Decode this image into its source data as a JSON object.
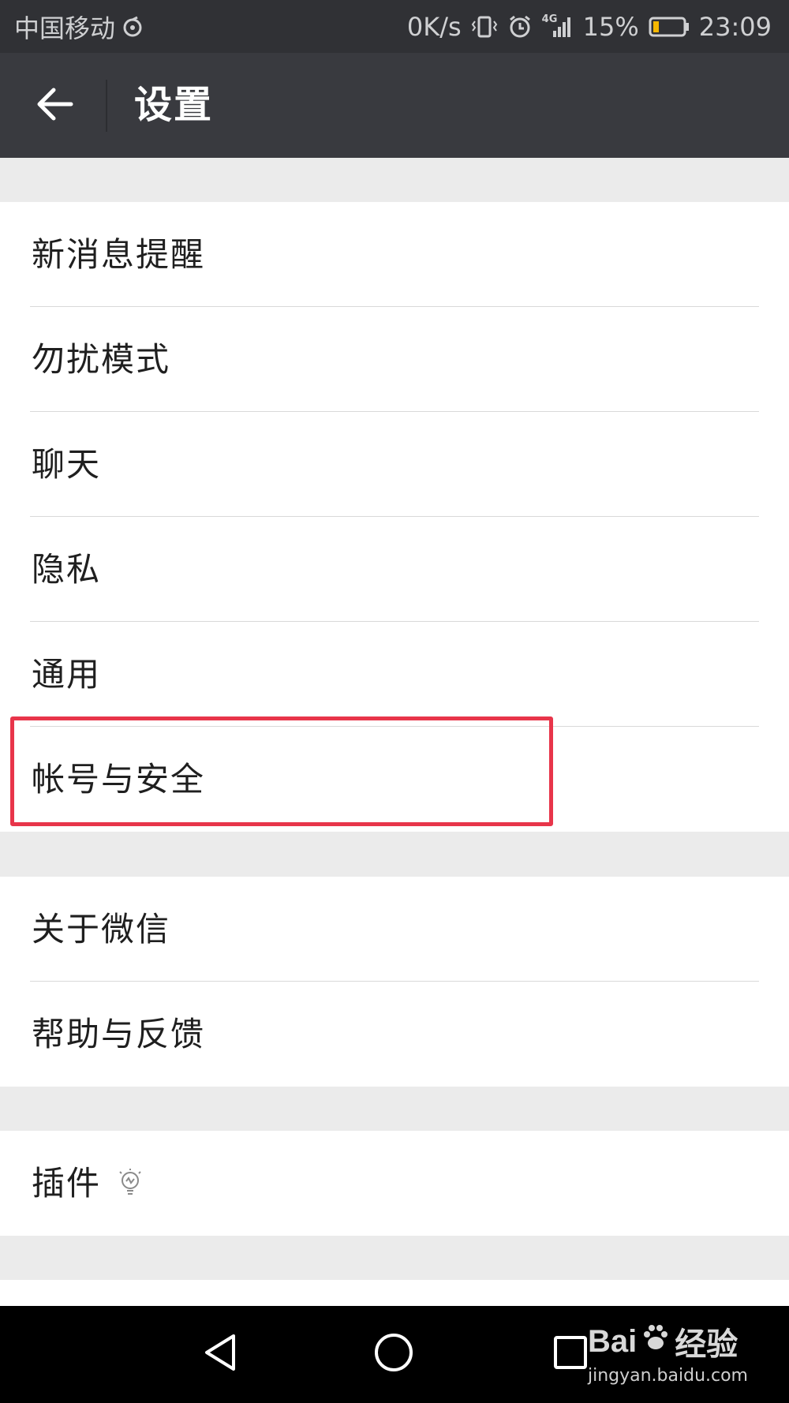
{
  "status_bar": {
    "carrier": "中国移动",
    "speed": "0K/s",
    "network": "4G",
    "battery": "15%",
    "time": "23:09"
  },
  "app_bar": {
    "title": "设置"
  },
  "groups": [
    {
      "items": [
        {
          "label": "新消息提醒"
        },
        {
          "label": "勿扰模式"
        },
        {
          "label": "聊天"
        },
        {
          "label": "隐私"
        },
        {
          "label": "通用"
        },
        {
          "label": "帐号与安全",
          "highlighted": true
        }
      ]
    },
    {
      "items": [
        {
          "label": "关于微信"
        },
        {
          "label": "帮助与反馈"
        }
      ]
    },
    {
      "items": [
        {
          "label": "插件",
          "icon": "lightbulb-icon"
        }
      ]
    }
  ],
  "watermark": {
    "brand_left": "Bai",
    "brand_right": "经验",
    "url": "jingyan.baidu.com"
  },
  "colors": {
    "status_bar": "#303135",
    "app_bar": "#393a3f",
    "background": "#ebebeb",
    "highlight": "#e8354a"
  }
}
